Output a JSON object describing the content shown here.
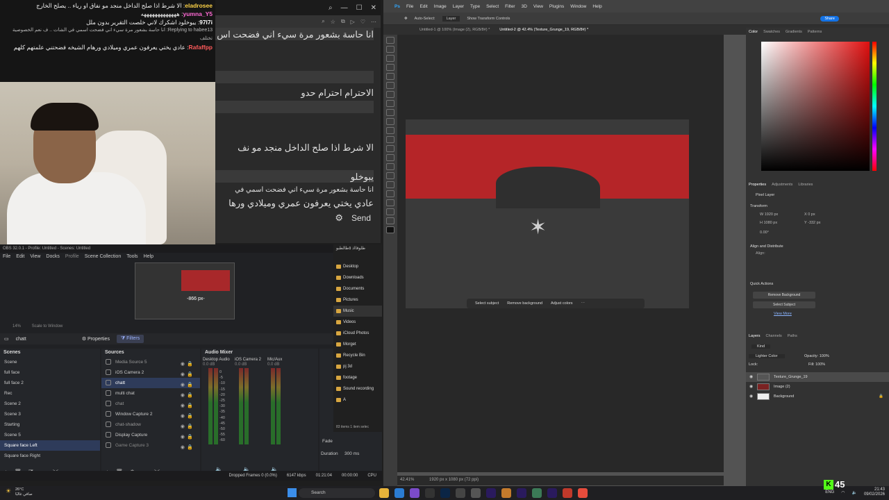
{
  "chat_overlay": {
    "messages": [
      {
        "user": "eladrosee",
        "text": "الا شرط اذا صلح الداخل منجد مو نفاق او رياء .. يصلح الخارج"
      },
      {
        "user": "yumna_Y5",
        "text": "هههههههههههههه"
      },
      {
        "user": "97l7i",
        "text": "يبوخلود اشكرك لاني خلصت التقرير بدون ملل"
      },
      {
        "user": "Replying to habee13",
        "text": "انا حاسة بشعور مرة سيء اني فضحت اسمي في الشات .. ف نعم الخصوصية تختلف"
      },
      {
        "user": "Rafaffpp",
        "text": "عادي يختي يعرفون عمري وميلادي ورهام الشيخه فضحتني علمتهم كلهم"
      }
    ]
  },
  "browser_chat": {
    "lines": [
      "انا حاسة بشعور مرة سيء اني فضحت اس",
      "الاحترام احترام حدو",
      "الا شرط اذا صلح الداخل منجد مو نف",
      "يبوخلو",
      "انا حاسة بشعور مرة سيء اني فضحت اسمي في",
      "عادي يختي يعرفون عمري وميلادي ورها"
    ],
    "send_label": "Send"
  },
  "obs": {
    "title": "OBS 32.0.1 - Profile: Untitled - Scenes: Untitled",
    "menu": [
      "File",
      "Edit",
      "View",
      "Docks",
      "Profile",
      "Scene Collection",
      "Tools",
      "Help"
    ],
    "preview_label": "-866 px-",
    "zoom": "14%",
    "zoom_mode": "Scale to Window",
    "selected_source": "chatt",
    "properties_label": "Properties",
    "filters_label": "Filters",
    "scenes_title": "Scenes",
    "scenes": [
      "Scene",
      "full face",
      "full face 2",
      "Rec",
      "Scene 2",
      "Scene 3",
      "Starting",
      "Scene 5",
      "Square face Left",
      "Square face Right"
    ],
    "selected_scene": "Square face Left",
    "sources_title": "Sources",
    "sources": [
      "Media Source 5",
      "iOS Camera 2",
      "chatt",
      "multi chat",
      "chat",
      "Window Capture 2",
      "chat-shadow",
      "Display Capture",
      "Game Capture 3"
    ],
    "mixer_title": "Audio Mixer",
    "channels": [
      {
        "name": "Desktop Audio",
        "db": "0.0 dB"
      },
      {
        "name": "iOS Camera 2",
        "db": "0.0 dB"
      },
      {
        "name": "Mic/Aux",
        "db": "0.0 dB"
      }
    ],
    "scale": [
      "0",
      "-5",
      "-10",
      "-15",
      "-20",
      "-25",
      "-30",
      "-35",
      "-40",
      "-45",
      "-50",
      "-55",
      "-60"
    ],
    "transition": {
      "type": "Fade",
      "duration_label": "Duration",
      "duration": "300 ms"
    },
    "status": {
      "dropped": "Dropped Frames 0 (0.0%)",
      "bitrate": "6147 kbps",
      "time1": "01:21:04",
      "time2": "00:00:00",
      "cpu": "CPU"
    }
  },
  "explorer": {
    "title": "طلوقااذ ٥طالطبو",
    "items": [
      "Desktop",
      "Downloads",
      "Documents",
      "Pictures",
      "Music",
      "Videos",
      "iCloud Photos",
      "Morget",
      "Recycle Bin",
      "pj 3d",
      "footage",
      "Sound recording",
      "A"
    ],
    "selected": "Music",
    "status": "83 items   1 item selec"
  },
  "photoshop": {
    "menu": [
      "Ps",
      "File",
      "Edit",
      "Image",
      "Layer",
      "Type",
      "Select",
      "Filter",
      "3D",
      "View",
      "Plugins",
      "Window",
      "Help"
    ],
    "options": [
      "Auto-Select:",
      "Layer",
      "Show Transform Controls"
    ],
    "share_label": "Share",
    "tabs": [
      "Untitled-1 @ 100% (Image (2), RGB/8#) *",
      "Untitled-2 @ 42.4% (Texture_Grunge_19, RGB/8#) *"
    ],
    "context_bar": [
      "Select subject",
      "Remove background",
      "Adjust colors"
    ],
    "zoom_status": "42.41%",
    "doc_status": "1920 px x 1080 px (72 ppi)",
    "color_tabs": [
      "Color",
      "Swatches",
      "Gradients",
      "Patterns"
    ],
    "props_tabs": [
      "Properties",
      "Adjustments",
      "Libraries"
    ],
    "pixel_layer": "Pixel Layer",
    "transform_title": "Transform",
    "transform": {
      "w": "1920 px",
      "h": "1080 px",
      "x": "0 px",
      "y": "-332 px",
      "angle": "0.00°"
    },
    "align_title": "Align and Distribute",
    "align_sub": "Align:",
    "quick_actions_title": "Quick Actions",
    "quick_actions": [
      "Remove Background",
      "Select Subject",
      "View More"
    ],
    "layers_tabs": [
      "Layers",
      "Channels",
      "Paths"
    ],
    "kind_label": "Kind",
    "blend_mode": "Lighter Color",
    "opacity_label": "Opacity:",
    "opacity": "100%",
    "fill_label": "Fill:",
    "fill": "100%",
    "lock_label": "Lock:",
    "layers": [
      "Texture_Grunge_19",
      "Image (2)",
      "Background"
    ]
  },
  "taskbar": {
    "weather_temp": "26°C",
    "weather_desc": "صافي غالبًا",
    "search_placeholder": "Search",
    "lang": "ENG",
    "time": "21:43",
    "date": "09/02/2026"
  },
  "kick": {
    "viewers": "45"
  }
}
